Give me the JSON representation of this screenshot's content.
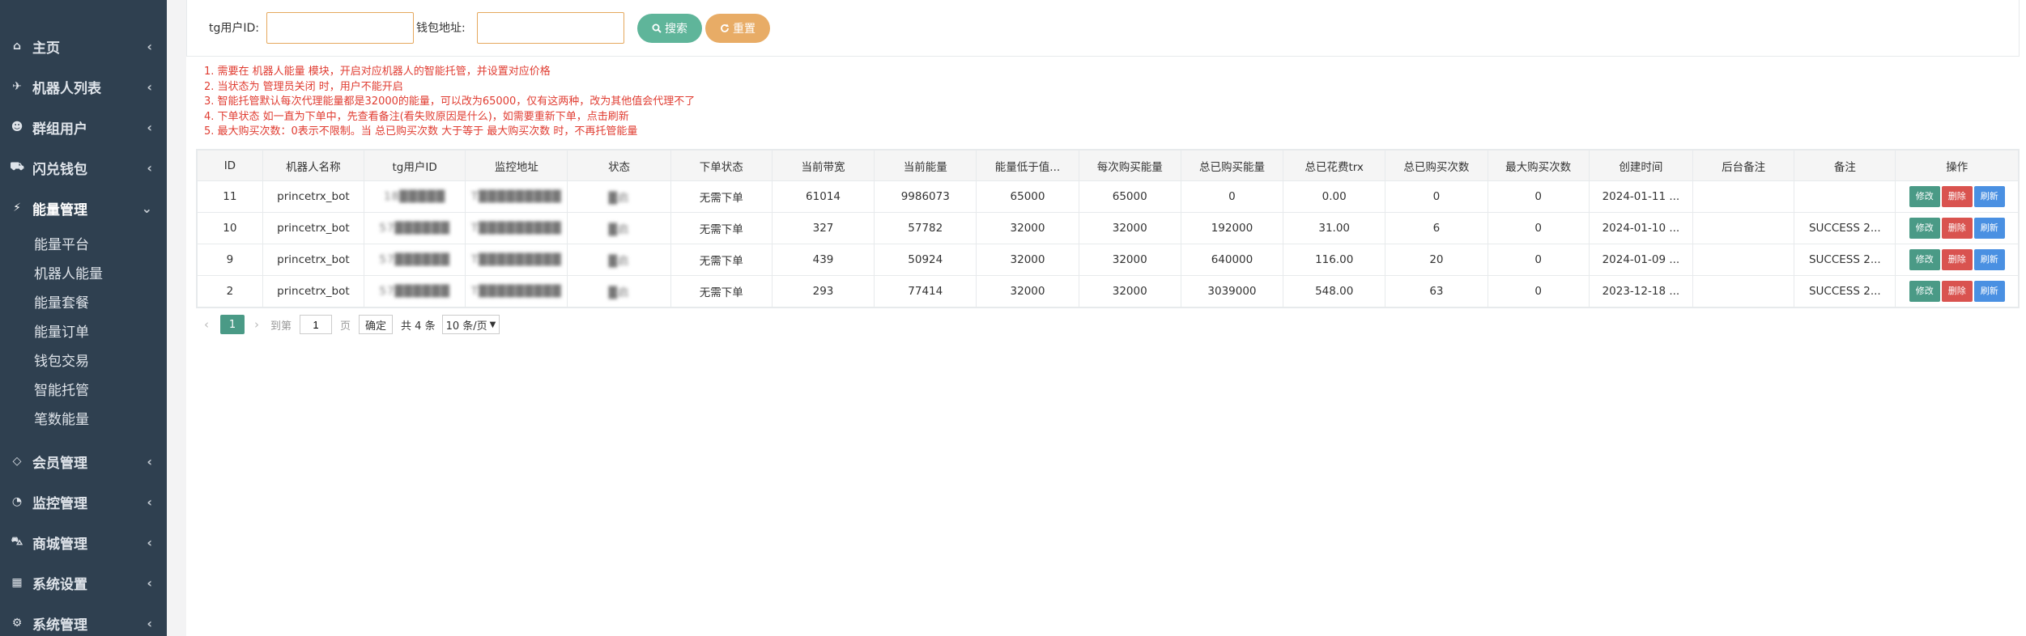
{
  "sidebar": {
    "top_items": [
      {
        "label": "主页",
        "icon": "home-icon"
      },
      {
        "label": "机器人列表",
        "icon": "plane-icon"
      },
      {
        "label": "群组用户",
        "icon": "group-icon"
      },
      {
        "label": "闪兑钱包",
        "icon": "car-icon"
      }
    ],
    "energy": {
      "label": "能量管理",
      "icon": "bolt-icon"
    },
    "sub_items": [
      "能量平台",
      "机器人能量",
      "能量套餐",
      "能量订单",
      "钱包交易",
      "智能托管",
      "笔数能量"
    ],
    "bottom_items": [
      {
        "label": "会员管理",
        "icon": "diamond-icon"
      },
      {
        "label": "监控管理",
        "icon": "pie-icon"
      },
      {
        "label": "商城管理",
        "icon": "cart-icon"
      },
      {
        "label": "系统设置",
        "icon": "windows-icon"
      },
      {
        "label": "系统管理",
        "icon": "gear-icon"
      }
    ]
  },
  "search": {
    "tg_label": "tg用户ID:",
    "wallet_label": "钱包地址:",
    "tg_value": "",
    "wallet_value": "",
    "search_btn": "搜索",
    "reset_btn": "重置",
    "colors": {
      "search": "#5fb59a",
      "reset": "#e8ac66"
    }
  },
  "notes": [
    "1. 需要在 机器人能量 模块，开启对应机器人的智能托管，并设置对应价格",
    "2. 当状态为 管理员关闭 时，用户不能开启",
    "3. 智能托管默认每次代理能量都是32000的能量，可以改为65000，仅有这两种，改为其他值会代理不了",
    "4. 下单状态 如一直为下单中，先查看备注(看失败原因是什么)，如需要重新下单，点击刷新",
    "5. 最大购买次数：0表示不限制。当 总已购买次数 大于等于 最大购买次数 时，不再托管能量"
  ],
  "table": {
    "headers": [
      "ID",
      "机器人名称",
      "tg用户ID",
      "监控地址",
      "状态",
      "下单状态",
      "当前带宽",
      "当前能量",
      "能量低于值...",
      "每次购买能量",
      "总已购买能量",
      "总已花费trx",
      "总已购买次数",
      "最大购买次数",
      "创建时间",
      "后台备注",
      "备注",
      "操作"
    ],
    "rows": [
      {
        "id": "11",
        "bot": "princetrx_bot",
        "tg": "18█████",
        "addr": "T█████████",
        "status": "█启",
        "order": "无需下单",
        "bw": "61014",
        "energy": "9986073",
        "low": "65000",
        "per": "65000",
        "total_energy": "0",
        "total_trx": "0.00",
        "total_times": "0",
        "max_times": "0",
        "created": "2024-01-11 ...",
        "admin_note": "",
        "note": ""
      },
      {
        "id": "10",
        "bot": "princetrx_bot",
        "tg": "57██████",
        "addr": "T█████████",
        "status": "█启",
        "order": "无需下单",
        "bw": "327",
        "energy": "57782",
        "low": "32000",
        "per": "32000",
        "total_energy": "192000",
        "total_trx": "31.00",
        "total_times": "6",
        "max_times": "0",
        "created": "2024-01-10 ...",
        "admin_note": "",
        "note": "SUCCESS 2..."
      },
      {
        "id": "9",
        "bot": "princetrx_bot",
        "tg": "57██████",
        "addr": "T█████████",
        "status": "█启",
        "order": "无需下单",
        "bw": "439",
        "energy": "50924",
        "low": "32000",
        "per": "32000",
        "total_energy": "640000",
        "total_trx": "116.00",
        "total_times": "20",
        "max_times": "0",
        "created": "2024-01-09 ...",
        "admin_note": "",
        "note": "SUCCESS 2..."
      },
      {
        "id": "2",
        "bot": "princetrx_bot",
        "tg": "57██████",
        "addr": "T█████████",
        "status": "█启",
        "order": "无需下单",
        "bw": "293",
        "energy": "77414",
        "low": "32000",
        "per": "32000",
        "total_energy": "3039000",
        "total_trx": "548.00",
        "total_times": "63",
        "max_times": "0",
        "created": "2023-12-18 ...",
        "admin_note": "",
        "note": "SUCCESS 2..."
      }
    ],
    "op_labels": {
      "edit": "修改",
      "delete": "删除",
      "refresh": "刷新"
    },
    "op_colors": {
      "edit": "#4a9a86",
      "delete": "#d9534f",
      "refresh": "#4a90e2"
    }
  },
  "pager": {
    "current": "1",
    "goto_label": "到第",
    "goto_value": "1",
    "page_unit": "页",
    "confirm": "确定",
    "total": "共 4 条",
    "per_page": "10 条/页"
  }
}
